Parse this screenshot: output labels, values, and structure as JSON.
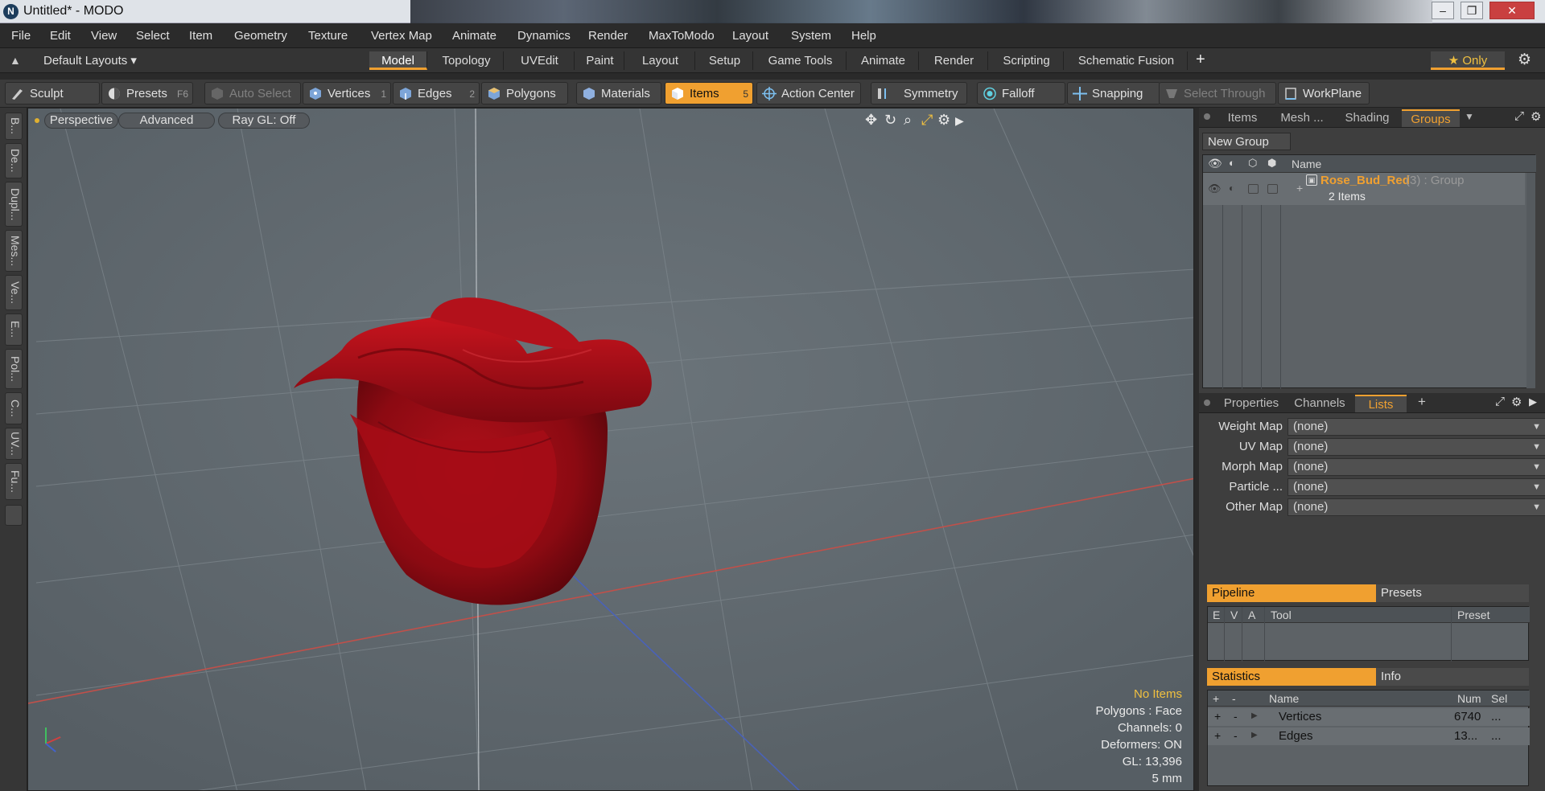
{
  "window": {
    "title": "Untitled* - MODO",
    "logo": "N"
  },
  "menu": [
    "File",
    "Edit",
    "View",
    "Select",
    "Item",
    "Geometry",
    "Texture",
    "Vertex Map",
    "Animate",
    "Dynamics",
    "Render",
    "MaxToModo",
    "Layout",
    "System",
    "Help"
  ],
  "layouts": {
    "default_label": "Default Layouts ▾",
    "tabs": [
      "Model",
      "Topology",
      "UVEdit",
      "Paint",
      "Layout",
      "Setup",
      "Game Tools",
      "Animate",
      "Render",
      "Scripting",
      "Schematic Fusion"
    ],
    "active": "Model",
    "add": "+",
    "only_label": "★  Only"
  },
  "toolbar": {
    "sculpt": "Sculpt",
    "presets": "Presets",
    "presets_key": "F6",
    "auto_select": "Auto Select",
    "vertices": "Vertices",
    "vertices_key": "1",
    "edges": "Edges",
    "edges_key": "2",
    "polygons": "Polygons",
    "materials": "Materials",
    "items": "Items",
    "items_key": "5",
    "action_center": "Action Center",
    "symmetry": "Symmetry",
    "falloff": "Falloff",
    "snapping": "Snapping",
    "select_through": "Select Through",
    "workplane": "WorkPlane"
  },
  "left_strip": [
    "B...",
    "De...",
    "Dupl...",
    "Mes...",
    "Ve...",
    "E...",
    "Pol...",
    "C...",
    "UV...",
    "Fu..."
  ],
  "viewport": {
    "perspective": "Perspective",
    "advanced": "Advanced",
    "raygl": "Ray GL: Off",
    "stats": {
      "no_items": "No Items",
      "polygons": "Polygons : Face",
      "channels": "Channels: 0",
      "deformers": "Deformers: ON",
      "gl": "GL: 13,396",
      "scale": "5 mm"
    },
    "accent": "#f0c040"
  },
  "groups_panel": {
    "tabs": [
      "Items",
      "Mesh ...",
      "Shading",
      "Groups"
    ],
    "active": "Groups",
    "new_group": "New Group",
    "col_name": "Name",
    "group_name": "Rose_Bud_Red",
    "group_suffix": "(3) : Group",
    "group_items": "2 Items",
    "accent": "#f0a030"
  },
  "lists_panel": {
    "tabs": [
      "Properties",
      "Channels",
      "Lists"
    ],
    "active": "Lists",
    "add": "+",
    "maps": [
      {
        "label": "Weight Map",
        "value": "(none)"
      },
      {
        "label": "UV Map",
        "value": "(none)"
      },
      {
        "label": "Morph Map",
        "value": "(none)"
      },
      {
        "label": "Particle ...",
        "value": "(none)"
      },
      {
        "label": "Other Map",
        "value": "(none)"
      }
    ],
    "pipeline": "Pipeline",
    "presets": "Presets",
    "pipe_cols": [
      "E",
      "V",
      "A",
      "Tool",
      "Preset"
    ],
    "statistics": "Statistics",
    "info": "Info",
    "stat_cols": [
      "+",
      "-",
      "Name",
      "Num",
      "Sel"
    ],
    "stat_rows": [
      {
        "plus": "+",
        "minus": "-",
        "name": "Vertices",
        "num": "6740",
        "sel": "..."
      },
      {
        "plus": "+",
        "minus": "-",
        "name": "Edges",
        "num": "13...",
        "sel": "..."
      }
    ]
  }
}
